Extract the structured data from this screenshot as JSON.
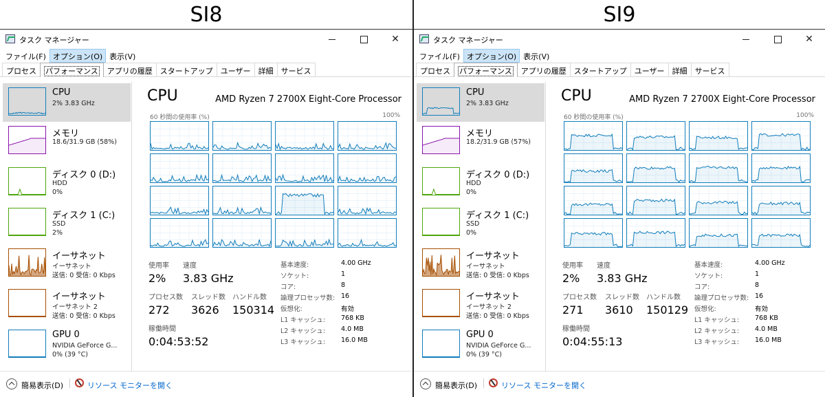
{
  "panels": [
    {
      "title": "SI8",
      "window": {
        "title": "タスク マネージャー"
      },
      "menu": [
        "ファイル(F)",
        "オプション(O)",
        "表示(V)"
      ],
      "tabs": [
        "プロセス",
        "パフォーマンス",
        "アプリの履歴",
        "スタートアップ",
        "ユーザー",
        "詳細",
        "サービス"
      ],
      "sidebar": [
        {
          "name": "CPU",
          "sub1": "2%  3.83 GHz",
          "sub2": ""
        },
        {
          "name": "メモリ",
          "sub1": "18.6/31.9 GB (58%)",
          "sub2": ""
        },
        {
          "name": "ディスク 0 (D:)",
          "sub1": "HDD",
          "sub2": "0%"
        },
        {
          "name": "ディスク 1 (C:)",
          "sub1": "SSD",
          "sub2": "2%"
        },
        {
          "name": "イーサネット",
          "sub1": "イーサネット",
          "sub2": "送信: 0 受信: 0 Kbps"
        },
        {
          "name": "イーサネット",
          "sub1": "イーサネット 2",
          "sub2": "送信: 0 受信: 0 Kbps"
        },
        {
          "name": "GPU 0",
          "sub1": "NVIDIA GeForce G...",
          "sub2": "0%  (39 °C)"
        }
      ],
      "main": {
        "title": "CPU",
        "processor": "AMD Ryzen 7 2700X Eight-Core Processor",
        "util_label": "60 秒間の使用率 (%)",
        "util_max": "100%",
        "stats": {
          "usage_label": "使用率",
          "usage": "2%",
          "speed_label": "速度",
          "speed": "3.83 GHz",
          "proc_label": "プロセス数",
          "proc": "272",
          "thread_label": "スレッド数",
          "thread": "3626",
          "handle_label": "ハンドル数",
          "handle": "150314",
          "uptime_label": "稼働時間",
          "uptime": "0:04:53:52"
        },
        "specs": [
          {
            "label": "基本速度:",
            "value": "4.00 GHz"
          },
          {
            "label": "ソケット:",
            "value": "1"
          },
          {
            "label": "コア:",
            "value": "8"
          },
          {
            "label": "論理プロセッサ数:",
            "value": "16"
          },
          {
            "label": "仮想化:",
            "value": "有効"
          },
          {
            "label": "L1 キャッシュ:",
            "value": "768 KB"
          },
          {
            "label": "L2 キャッシュ:",
            "value": "4.0 MB"
          },
          {
            "label": "L3 キャッシュ:",
            "value": "16.0 MB"
          }
        ]
      },
      "footer": {
        "fewer": "簡易表示(D)",
        "resmon": "リソース モニターを開く"
      }
    },
    {
      "title": "SI9",
      "window": {
        "title": "タスク マネージャー"
      },
      "menu": [
        "ファイル(F)",
        "オプション(O)",
        "表示(V)"
      ],
      "tabs": [
        "プロセス",
        "パフォーマンス",
        "アプリの履歴",
        "スタートアップ",
        "ユーザー",
        "詳細",
        "サービス"
      ],
      "sidebar": [
        {
          "name": "CPU",
          "sub1": "2%  3.83 GHz",
          "sub2": ""
        },
        {
          "name": "メモリ",
          "sub1": "18.2/31.9 GB (57%)",
          "sub2": ""
        },
        {
          "name": "ディスク 0 (D:)",
          "sub1": "HDD",
          "sub2": "0%"
        },
        {
          "name": "ディスク 1 (C:)",
          "sub1": "SSD",
          "sub2": "0%"
        },
        {
          "name": "イーサネット",
          "sub1": "イーサネット",
          "sub2": "送信: 0 受信: 0 Kbps"
        },
        {
          "name": "イーサネット",
          "sub1": "イーサネット 2",
          "sub2": "送信: 0 受信: 0 Kbps"
        },
        {
          "name": "GPU 0",
          "sub1": "NVIDIA GeForce G...",
          "sub2": "0%  (39 °C)"
        }
      ],
      "main": {
        "title": "CPU",
        "processor": "AMD Ryzen 7 2700X Eight-Core Processor",
        "util_label": "60 秒間の使用率 (%)",
        "util_max": "100%",
        "stats": {
          "usage_label": "使用率",
          "usage": "2%",
          "speed_label": "速度",
          "speed": "3.83 GHz",
          "proc_label": "プロセス数",
          "proc": "271",
          "thread_label": "スレッド数",
          "thread": "3610",
          "handle_label": "ハンドル数",
          "handle": "150129",
          "uptime_label": "稼働時間",
          "uptime": "0:04:55:13"
        },
        "specs": [
          {
            "label": "基本速度:",
            "value": "4.00 GHz"
          },
          {
            "label": "ソケット:",
            "value": "1"
          },
          {
            "label": "コア:",
            "value": "8"
          },
          {
            "label": "論理プロセッサ数:",
            "value": "16"
          },
          {
            "label": "仮想化:",
            "value": "有効"
          },
          {
            "label": "L1 キャッシュ:",
            "value": "768 KB"
          },
          {
            "label": "L2 キャッシュ:",
            "value": "4.0 MB"
          },
          {
            "label": "L3 キャッシュ:",
            "value": "16.0 MB"
          }
        ]
      },
      "footer": {
        "fewer": "簡易表示(D)",
        "resmon": "リソース モニターを開く"
      }
    }
  ],
  "colors": {
    "cpu": "#117dbb",
    "memory": "#8b12ae",
    "disk": "#4da60c",
    "ethernet": "#a74f01",
    "gpu": "#117dbb",
    "selected": "#dadada",
    "link": "#0066cc"
  },
  "icons": [
    "task-manager-icon",
    "minimize-icon",
    "maximize-icon",
    "close-icon",
    "chevron-up-icon",
    "resource-monitor-icon"
  ]
}
